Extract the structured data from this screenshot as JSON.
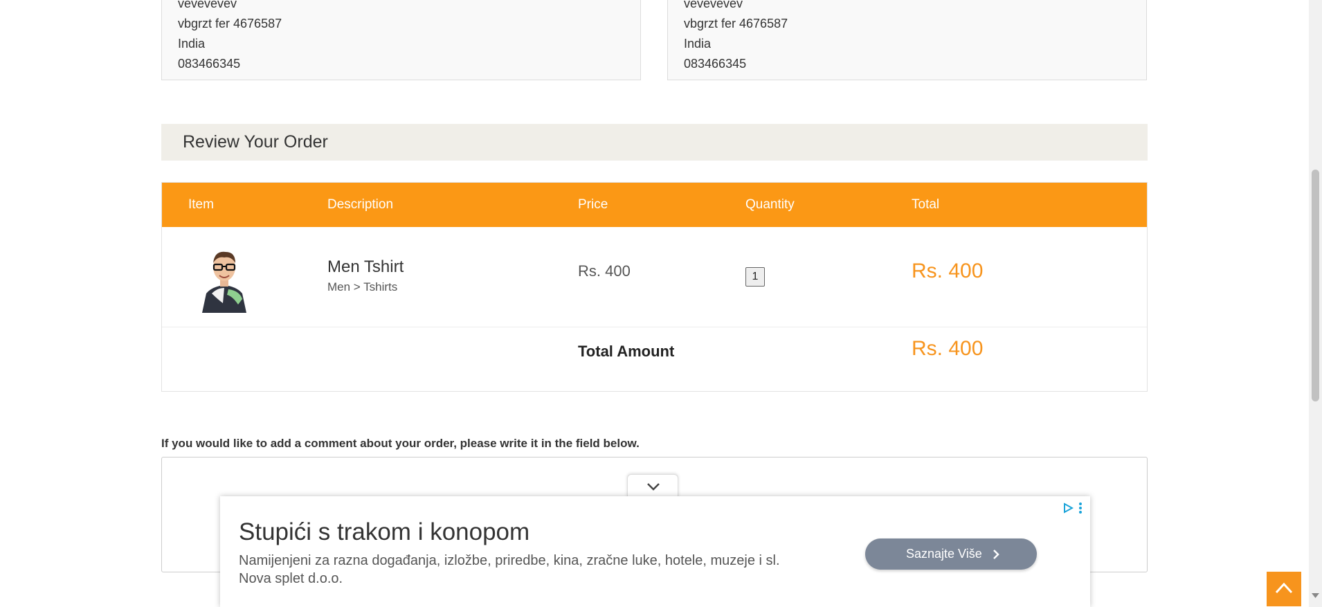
{
  "addresses": [
    {
      "lines": [
        "vevevevev",
        "vbgrzt fer 4676587",
        "India",
        "083466345"
      ]
    },
    {
      "lines": [
        "vevevevev",
        "vbgrzt fer 4676587",
        "India",
        "083466345"
      ]
    }
  ],
  "review": {
    "title": "Review Your Order",
    "columns": [
      "Item",
      "Description",
      "Price",
      "Quantity",
      "Total"
    ],
    "items": [
      {
        "name": "Men Tshirt",
        "category": "Men > Tshirts",
        "price": "Rs. 400",
        "quantity": "1",
        "total": "Rs. 400"
      }
    ],
    "total_label": "Total Amount",
    "total_value": "Rs. 400"
  },
  "comment": {
    "label": "If you would like to add a comment about your order, please write it in the field below.",
    "value": ""
  },
  "ad": {
    "title": "Stupići s trakom i konopom",
    "description": "Namijenjeni za razna događanja, izložbe, priredbe, kina, zračne luke, hotele, muzeje i sl.",
    "company": "Nova splet d.o.o.",
    "cta": "Saznajte Više",
    "cta_color": "#7c8798"
  },
  "colors": {
    "accent": "#fb9815",
    "price_highlight": "#f7941d",
    "review_header_bg": "#f0eee8"
  },
  "icons": [
    "chevron-down-icon",
    "adchoices-icon",
    "more-vertical-icon",
    "chevron-right-icon",
    "arrow-up-icon",
    "product-thumbnail"
  ]
}
